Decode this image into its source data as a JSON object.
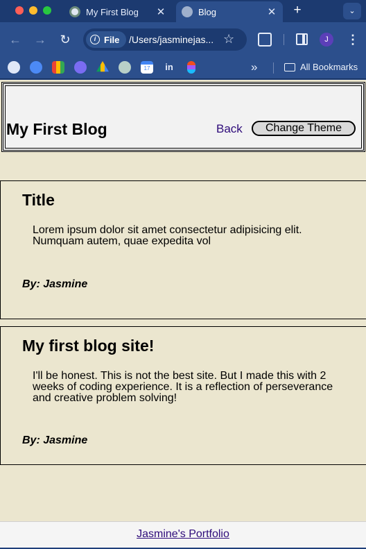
{
  "browser": {
    "tabs": [
      {
        "label": "My First Blog",
        "close": "✕"
      },
      {
        "label": "Blog",
        "close": "✕"
      }
    ],
    "new_tab": "+",
    "tab_search": "⌄",
    "url_chip": "File",
    "url": "/Users/jasminejas...",
    "avatar_initial": "J",
    "bookmarks_more": "»",
    "bookmarks_folder": "All Bookmarks",
    "bookmark_icons": [
      "globe-icon",
      "chrome-icon",
      "gmail-icon",
      "app-icon",
      "drive-icon",
      "chatgpt-icon",
      "calendar-icon",
      "linkedin-icon",
      "figma-icon"
    ],
    "calendar_day": "17",
    "linkedin_text": "in"
  },
  "header": {
    "title": "My First Blog",
    "back_label": "Back",
    "theme_button": "Change Theme"
  },
  "posts": [
    {
      "title": "Title",
      "body": "Lorem ipsum dolor sit amet consectetur adipisicing elit. Numquam autem, quae expedita vol",
      "author": "By: Jasmine"
    },
    {
      "title": "My first blog site!",
      "body": "I'll be honest. This is not the best site. But I made this with 2 weeks of coding experience. It is a reflection of perseverance and creative problem solving!",
      "author": "By: Jasmine"
    }
  ],
  "footer": {
    "link": "Jasmine's Portfolio"
  },
  "colors": {
    "page_background": "#ebe6cf",
    "header_background": "#f2f2f2",
    "link": "#2e0b7a",
    "browser_chrome": "#2c4f8c"
  }
}
